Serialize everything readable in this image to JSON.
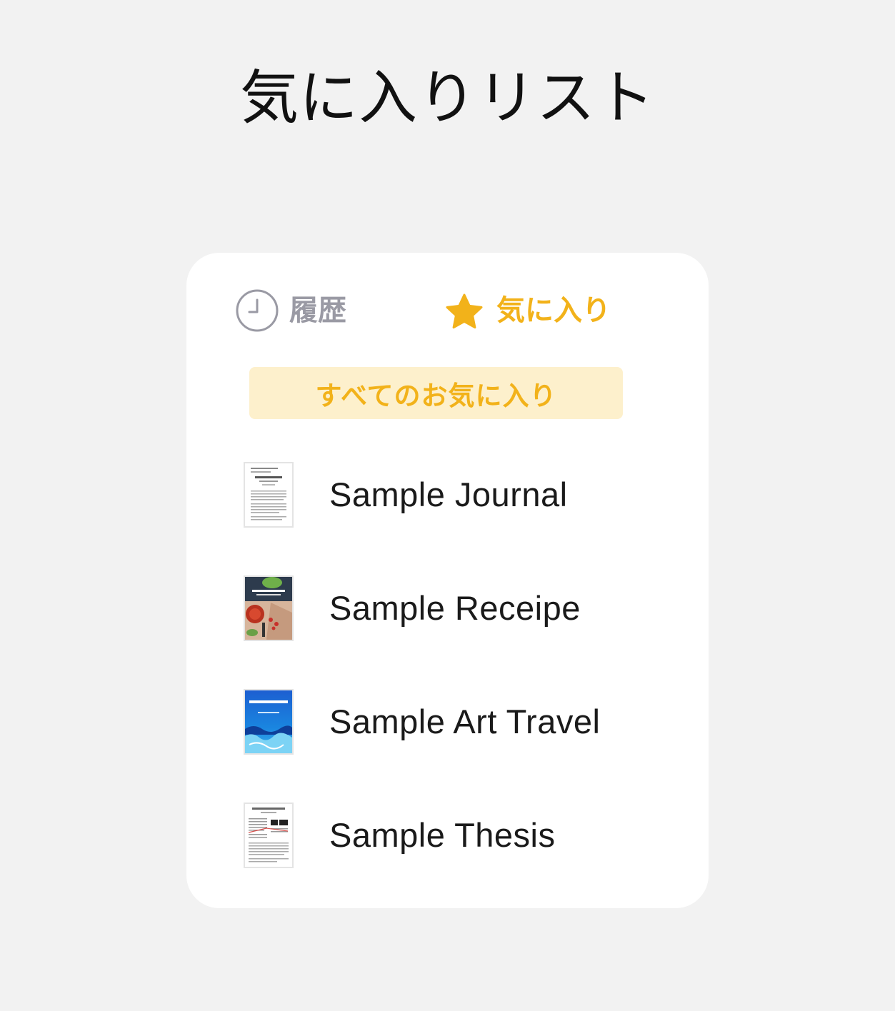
{
  "page": {
    "heading": "気に入りリスト"
  },
  "tabs": {
    "history": {
      "label": "履歴",
      "icon": "clock-icon",
      "color": "#9a9aa4"
    },
    "favorites": {
      "label": "気に入り",
      "icon": "star-icon",
      "color": "#f2b21a",
      "selected": true
    }
  },
  "filter": {
    "label": "すべてのお気に入り",
    "background": "#fdf0cc",
    "text_color": "#f2b21a"
  },
  "documents": [
    {
      "title": "Sample Journal",
      "thumbnail": "journal-thumbnail"
    },
    {
      "title": "Sample Receipe",
      "thumbnail": "recipe-thumbnail"
    },
    {
      "title": "Sample Art Travel",
      "thumbnail": "art-travel-thumbnail"
    },
    {
      "title": "Sample Thesis",
      "thumbnail": "thesis-thumbnail"
    }
  ]
}
